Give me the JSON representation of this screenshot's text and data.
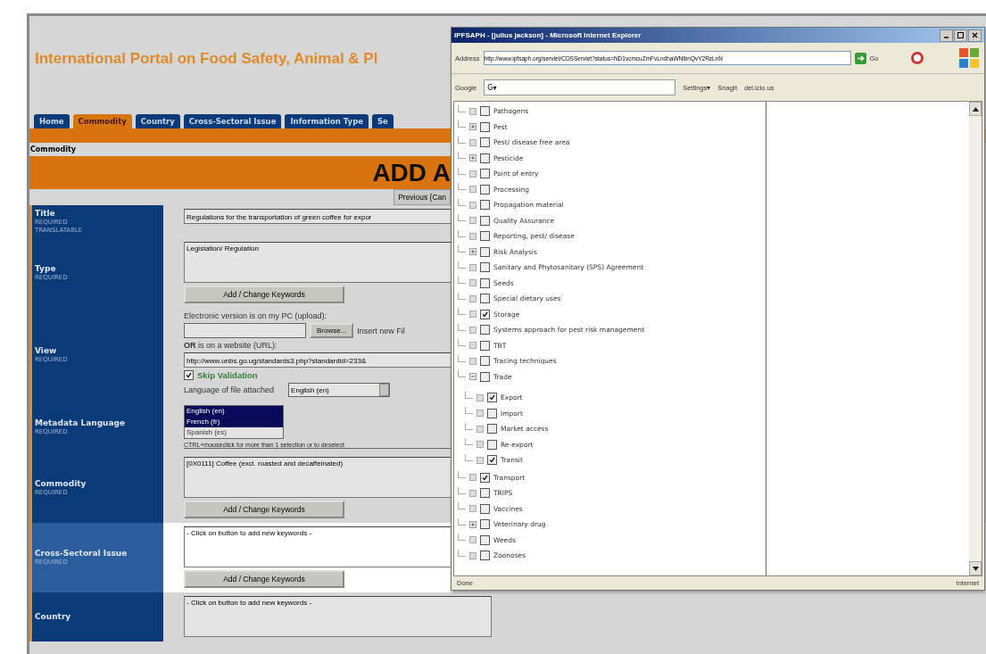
{
  "portal": {
    "title": "International Portal on Food Safety, Animal & Pl",
    "tabs": [
      {
        "label": "Home",
        "selected": false
      },
      {
        "label": "Commodity",
        "selected": true
      },
      {
        "label": "Country",
        "selected": false
      },
      {
        "label": "Cross-Sectoral Issue",
        "selected": false
      },
      {
        "label": "Information Type",
        "selected": false
      },
      {
        "label": "Se",
        "selected": false
      }
    ],
    "breadcrumb": "Commodity",
    "heading": "ADD A",
    "previous_button": "Previous (Can",
    "rows": [
      {
        "label": "Title",
        "notes": [
          "REQUIRED",
          "TRANSLATABLE"
        ],
        "highlighted": false,
        "fields": [
          {
            "kind": "input",
            "value": "Regulations for the transportation of green coffee for expor"
          }
        ]
      },
      {
        "label": "Type",
        "notes": [
          "REQUIRED"
        ],
        "highlighted": false,
        "fields": [
          {
            "kind": "textarea",
            "value": "Legislation/ Regulation"
          },
          {
            "kind": "button",
            "label": "Add / Change Keywords"
          }
        ]
      },
      {
        "label": "View",
        "notes": [
          "REQUIRED"
        ],
        "highlighted": false,
        "fields": [
          {
            "kind": "text",
            "text": "Electronic version is on my PC (upload):"
          },
          {
            "kind": "file",
            "button": "Browse...",
            "after": "Insert new Fil"
          },
          {
            "kind": "text",
            "text": "**OR** is on a website (URL):"
          },
          {
            "kind": "input",
            "value": "http://www.unbs.go.ug/standards3.php?standardid=233&"
          },
          {
            "kind": "checkbox",
            "label": "Skip Validation",
            "checked": true
          },
          {
            "kind": "select",
            "label": "Language of file attached",
            "value": "English (en)"
          }
        ]
      },
      {
        "label": "Metadata Language",
        "notes": [
          "REQUIRED"
        ],
        "highlighted": false,
        "fields": [
          {
            "kind": "listbox",
            "options": [
              {
                "label": "English (en)",
                "selected": true
              },
              {
                "label": "French (fr)",
                "selected": true
              },
              {
                "label": "Spanish (es)",
                "selected": false
              }
            ]
          },
          {
            "kind": "hint",
            "text": "CTRL+mouseclick for more than 1 selection or to deselect"
          }
        ]
      },
      {
        "label": "Commodity",
        "notes": [
          "REQUIRED"
        ],
        "highlighted": false,
        "fields": [
          {
            "kind": "textarea",
            "value": "[0X0111] Coffee (excl. roasted and decaffeinated)"
          },
          {
            "kind": "button",
            "label": "Add / Change Keywords"
          }
        ]
      },
      {
        "label": "Cross-Sectoral Issue",
        "notes": [
          "REQUIRED"
        ],
        "highlighted": true,
        "fields": [
          {
            "kind": "textarea",
            "value": "- Click on button to add new keywords -"
          },
          {
            "kind": "button",
            "label": "Add / Change Keywords"
          }
        ]
      },
      {
        "label": "Country",
        "notes": [],
        "highlighted": false,
        "fields": [
          {
            "kind": "textarea",
            "value": "- Click on button to add new keywords -"
          }
        ]
      }
    ]
  },
  "popup": {
    "title": "IPFSAPH - [julius jackson] - Microsoft Internet Explorer",
    "address_label": "Address",
    "address": "http://www.ipfsaph.org/servlet/CDSServlet?status=ND1vcmcuZmFvLndhaWNlbnQvY2RzLnN",
    "go": "Go",
    "google_label": "Google",
    "google_menu": "G▾",
    "toolbar": [
      "Settings▾",
      "SnagIt",
      "del.icio.us"
    ],
    "tree": [
      {
        "label": "Pathogens",
        "kind": "leaf",
        "checked": false
      },
      {
        "label": "Pest",
        "kind": "folder",
        "expanded": false,
        "checked": false
      },
      {
        "label": "Pest/ disease free area",
        "kind": "leaf",
        "checked": false
      },
      {
        "label": "Pesticide",
        "kind": "folder",
        "expanded": false,
        "checked": false
      },
      {
        "label": "Point of entry",
        "kind": "leaf",
        "checked": false
      },
      {
        "label": "Processing",
        "kind": "leaf",
        "checked": false
      },
      {
        "label": "Propagation material",
        "kind": "leaf",
        "checked": false
      },
      {
        "label": "Quality Assurance",
        "kind": "leaf",
        "checked": false
      },
      {
        "label": "Reporting, pest/ disease",
        "kind": "leaf",
        "checked": false
      },
      {
        "label": "Risk Analysis",
        "kind": "folder",
        "expanded": false,
        "checked": false
      },
      {
        "label": "Sanitary and Phytosanitary (SPS) Agreement",
        "kind": "leaf",
        "checked": false
      },
      {
        "label": "Seeds",
        "kind": "leaf",
        "checked": false
      },
      {
        "label": "Special dietary uses",
        "kind": "leaf",
        "checked": false
      },
      {
        "label": "Storage",
        "kind": "leaf",
        "checked": true
      },
      {
        "label": "Systems approach for pest risk management",
        "kind": "leaf",
        "checked": false
      },
      {
        "label": "TBT",
        "kind": "leaf",
        "checked": false
      },
      {
        "label": "Tracing techniques",
        "kind": "leaf",
        "checked": false
      },
      {
        "label": "Trade",
        "kind": "folder",
        "expanded": true,
        "checked": false,
        "children": [
          {
            "label": "Export",
            "kind": "leaf",
            "checked": true
          },
          {
            "label": "Import",
            "kind": "leaf",
            "checked": false
          },
          {
            "label": "Market access",
            "kind": "leaf",
            "checked": false
          },
          {
            "label": "Re-export",
            "kind": "leaf",
            "checked": false
          },
          {
            "label": "Transit",
            "kind": "leaf",
            "checked": true
          }
        ]
      },
      {
        "label": "Transport",
        "kind": "leaf",
        "checked": true
      },
      {
        "label": "TRIPS",
        "kind": "leaf",
        "checked": false
      },
      {
        "label": "Vaccines",
        "kind": "leaf",
        "checked": false
      },
      {
        "label": "Veterinary drug",
        "kind": "folder",
        "expanded": false,
        "checked": false
      },
      {
        "label": "Weeds",
        "kind": "leaf",
        "checked": false
      },
      {
        "label": "Zoonoses",
        "kind": "leaf",
        "checked": false
      }
    ],
    "status": "Done",
    "zone": "Internet"
  }
}
